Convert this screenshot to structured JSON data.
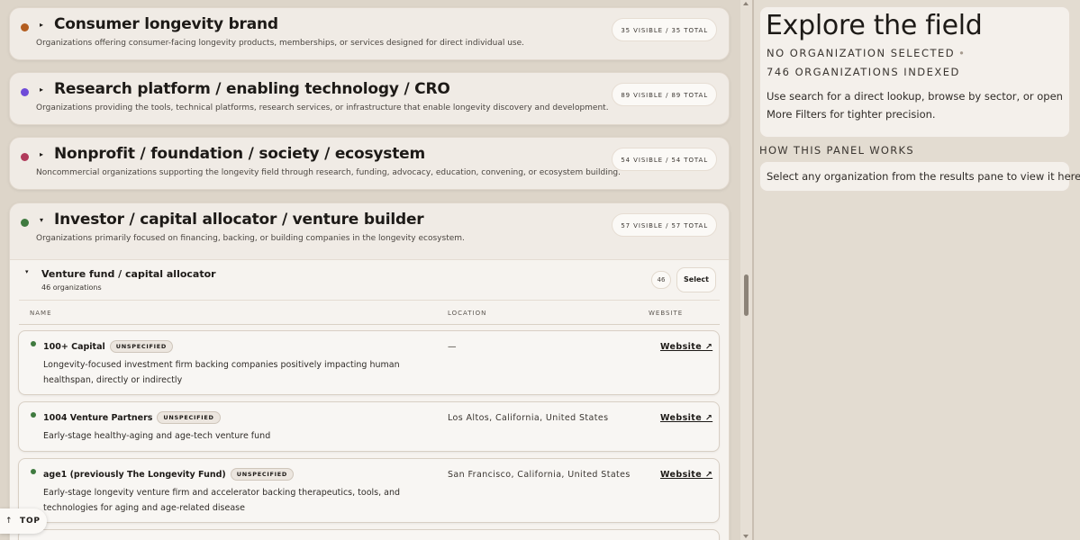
{
  "groups": [
    {
      "title": "Consumer longevity brand",
      "description": "Organizations offering consumer-facing longevity products, memberships, or services designed for direct individual use.",
      "count": "35 VISIBLE / 35 TOTAL",
      "color": "#b35d1f",
      "expanded": false
    },
    {
      "title": "Research platform / enabling technology / CRO",
      "description": "Organizations providing the tools, technical platforms, research services, or infrastructure that enable longevity discovery and development.",
      "count": "89 VISIBLE / 89 TOTAL",
      "color": "#6f4bd8",
      "expanded": false
    },
    {
      "title": "Nonprofit / foundation / society / ecosystem",
      "description": "Noncommercial organizations supporting the longevity field through research, funding, advocacy, education, convening, or ecosystem building.",
      "count": "54 VISIBLE / 54 TOTAL",
      "color": "#b03a5a",
      "expanded": false
    },
    {
      "title": "Investor / capital allocator / venture builder",
      "description": "Organizations primarily focused on financing, backing, or building companies in the longevity ecosystem.",
      "count": "57 VISIBLE / 57 TOTAL",
      "color": "#3f7a3f",
      "expanded": true
    }
  ],
  "subgroup": {
    "title": "Venture fund / capital allocator",
    "subtitle": "46 organizations",
    "count": "46",
    "select_label": "Select",
    "columns": {
      "name": "NAME",
      "location": "LOCATION",
      "website": "WEBSITE"
    }
  },
  "rows": [
    {
      "name": "100+ Capital",
      "badge": "UNSPECIFIED",
      "description": "Longevity-focused investment firm backing companies positively impacting human healthspan, directly or indirectly",
      "location": "—",
      "website": "Website ↗"
    },
    {
      "name": "1004 Venture Partners",
      "badge": "UNSPECIFIED",
      "description": "Early-stage healthy-aging and age-tech venture fund",
      "location": "Los Altos, California, United States",
      "website": "Website ↗"
    },
    {
      "name": "age1 (previously The Longevity Fund)",
      "badge": "UNSPECIFIED",
      "description": "Early-stage longevity venture firm and accelerator backing therapeutics, tools, and technologies for aging and age-related disease",
      "location": "San Francisco, California, United States",
      "website": "Website ↗"
    }
  ],
  "top_button": {
    "arrow": "↑",
    "label": "TOP"
  },
  "explore": {
    "title": "Explore the field",
    "selection": "NO ORGANIZATION SELECTED",
    "bullet": "•",
    "indexed": "746 ORGANIZATIONS INDEXED",
    "help": "Use search for a direct lookup, browse by sector, or open More Filters for tighter precision."
  },
  "panel_help": {
    "label": "HOW THIS PANEL WORKS",
    "text": "Select any organization from the results pane to view it here."
  }
}
